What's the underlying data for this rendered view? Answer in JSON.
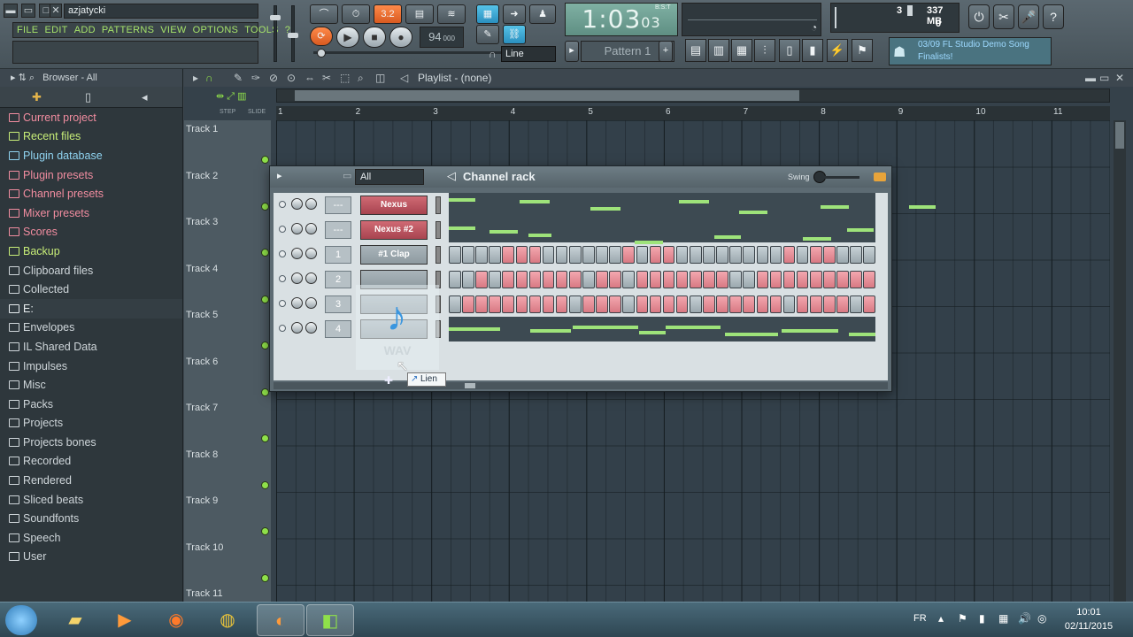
{
  "app": {
    "project_name": "azjatycki",
    "menu": [
      "FILE",
      "EDIT",
      "ADD",
      "PATTERNS",
      "VIEW",
      "OPTIONS",
      "TOOLS",
      "?"
    ],
    "tempo": "94",
    "tempo_decimals": "000",
    "time_main": "1:03",
    "time_sub": "03",
    "time_label": "B:S:T",
    "pattern": "Pattern 1",
    "snap_mode": "Line",
    "cpu_voices": "3",
    "memory": "337 MB",
    "cpu_load": "0",
    "news_line1": "03/09  FL Studio Demo Song",
    "news_line2": "Finalists!",
    "accent_orange": "#e8782e",
    "accent_green": "#a6e36a"
  },
  "browser": {
    "title": "Browser - All",
    "items": [
      {
        "label": "Current project",
        "icon": "project-icon",
        "color": "#f28da0"
      },
      {
        "label": "Recent files",
        "icon": "folder-icon",
        "color": "#c8ee78"
      },
      {
        "label": "Plugin database",
        "icon": "plugin-icon",
        "color": "#8fd3f0"
      },
      {
        "label": "Plugin presets",
        "icon": "plugin-icon",
        "color": "#f28da0"
      },
      {
        "label": "Channel presets",
        "icon": "preset-icon",
        "color": "#f28da0"
      },
      {
        "label": "Mixer presets",
        "icon": "mixer-icon",
        "color": "#f28da0"
      },
      {
        "label": "Scores",
        "icon": "note-icon",
        "color": "#f28da0"
      },
      {
        "label": "Backup",
        "icon": "folder-icon",
        "color": "#c8ee78"
      },
      {
        "label": "Clipboard files",
        "icon": "folder-icon",
        "color": "#cfd6da"
      },
      {
        "label": "Collected",
        "icon": "folder-icon",
        "color": "#cfd6da"
      },
      {
        "label": "E:",
        "icon": "drive-icon",
        "color": "#e8eef0"
      },
      {
        "label": "Envelopes",
        "icon": "folder-icon",
        "color": "#cfd6da"
      },
      {
        "label": "IL Shared Data",
        "icon": "folder-icon",
        "color": "#cfd6da"
      },
      {
        "label": "Impulses",
        "icon": "folder-icon",
        "color": "#cfd6da"
      },
      {
        "label": "Misc",
        "icon": "folder-icon",
        "color": "#cfd6da"
      },
      {
        "label": "Packs",
        "icon": "folder-icon",
        "color": "#cfd6da"
      },
      {
        "label": "Projects",
        "icon": "folder-icon",
        "color": "#cfd6da"
      },
      {
        "label": "Projects bones",
        "icon": "folder-icon",
        "color": "#cfd6da"
      },
      {
        "label": "Recorded",
        "icon": "folder-icon",
        "color": "#cfd6da"
      },
      {
        "label": "Rendered",
        "icon": "folder-icon",
        "color": "#cfd6da"
      },
      {
        "label": "Sliced beats",
        "icon": "folder-icon",
        "color": "#cfd6da"
      },
      {
        "label": "Soundfonts",
        "icon": "folder-icon",
        "color": "#cfd6da"
      },
      {
        "label": "Speech",
        "icon": "folder-icon",
        "color": "#cfd6da"
      },
      {
        "label": "User",
        "icon": "folder-icon",
        "color": "#cfd6da"
      }
    ]
  },
  "playlist": {
    "title": "Playlist - (none)",
    "step_label": "STEP",
    "slide_label": "SLIDE",
    "bars": [
      "1",
      "2",
      "3",
      "4",
      "5",
      "6",
      "7",
      "8",
      "9",
      "10",
      "11"
    ],
    "tracks": [
      "Track 1",
      "Track 2",
      "Track 3",
      "Track 4",
      "Track 5",
      "Track 6",
      "Track 7",
      "Track 8",
      "Track 9",
      "Track 10",
      "Track 11"
    ]
  },
  "channel_rack": {
    "title": "Channel rack",
    "filter": "All",
    "swing_label": "Swing",
    "channels": [
      {
        "name": "Nexus",
        "mixer": "---",
        "style": "red",
        "view": "roll"
      },
      {
        "name": "Nexus #2",
        "mixer": "---",
        "style": "red",
        "view": "roll"
      },
      {
        "name": "#1 Clap",
        "mixer": "1",
        "style": "gray",
        "view": "steps"
      },
      {
        "name": "",
        "mixer": "2",
        "style": "gray",
        "view": "steps"
      },
      {
        "name": "",
        "mixer": "3",
        "style": "gray",
        "view": "steps"
      },
      {
        "name": "",
        "mixer": "4",
        "style": "gray",
        "view": "roll"
      }
    ]
  },
  "drag": {
    "file_ext": "WAV",
    "tooltip": "Lien"
  },
  "taskbar": {
    "lang": "FR",
    "time": "10:01",
    "date": "02/11/2015"
  }
}
